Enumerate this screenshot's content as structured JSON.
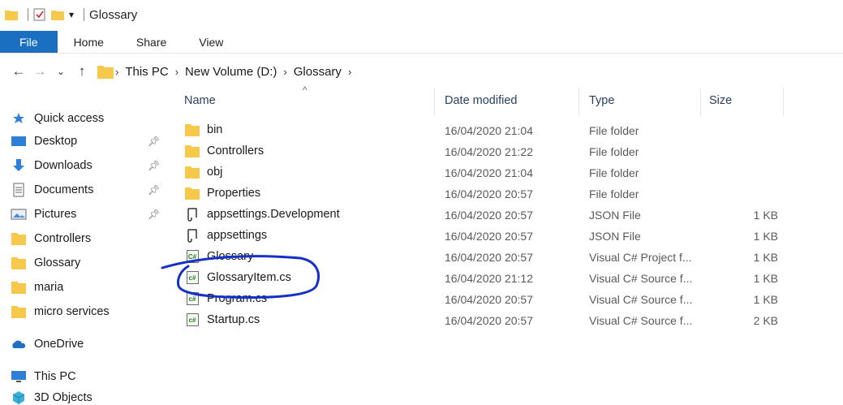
{
  "window": {
    "title": "Glossary",
    "ribbon_tabs": [
      {
        "label": "File",
        "active": true
      },
      {
        "label": "Home"
      },
      {
        "label": "Share"
      },
      {
        "label": "View"
      }
    ]
  },
  "navigation": {
    "back_icon": "arrow-left-icon",
    "forward_icon": "arrow-right-icon",
    "recent_icon": "chevron-down-icon",
    "up_icon": "arrow-up-icon",
    "breadcrumb": [
      "This PC",
      "New Volume (D:)",
      "Glossary"
    ]
  },
  "sidebar": {
    "items": [
      {
        "label": "Quick access",
        "icon": "star-icon"
      },
      {
        "label": "Desktop",
        "icon": "desktop-icon",
        "pinned": true
      },
      {
        "label": "Downloads",
        "icon": "download-icon",
        "pinned": true
      },
      {
        "label": "Documents",
        "icon": "documents-icon",
        "pinned": true
      },
      {
        "label": "Pictures",
        "icon": "pictures-icon",
        "pinned": true
      },
      {
        "label": "Controllers",
        "icon": "folder-icon"
      },
      {
        "label": "Glossary",
        "icon": "folder-icon"
      },
      {
        "label": "maria",
        "icon": "folder-icon"
      },
      {
        "label": "micro services",
        "icon": "folder-icon"
      },
      {
        "label": "OneDrive",
        "icon": "cloud-icon"
      },
      {
        "label": "This PC",
        "icon": "computer-icon"
      },
      {
        "label": "3D Objects",
        "icon": "cube-icon"
      }
    ]
  },
  "list": {
    "columns": [
      "Name",
      "Date modified",
      "Type",
      "Size"
    ],
    "rows": [
      {
        "name": "bin",
        "date": "16/04/2020 21:04",
        "type": "File folder",
        "size": "",
        "icon": "folder-icon"
      },
      {
        "name": "Controllers",
        "date": "16/04/2020 21:22",
        "type": "File folder",
        "size": "",
        "icon": "folder-icon"
      },
      {
        "name": "obj",
        "date": "16/04/2020 21:04",
        "type": "File folder",
        "size": "",
        "icon": "folder-icon"
      },
      {
        "name": "Properties",
        "date": "16/04/2020 20:57",
        "type": "File folder",
        "size": "",
        "icon": "folder-icon"
      },
      {
        "name": "appsettings.Development",
        "date": "16/04/2020 20:57",
        "type": "JSON File",
        "size": "1 KB",
        "icon": "json-file-icon"
      },
      {
        "name": "appsettings",
        "date": "16/04/2020 20:57",
        "type": "JSON File",
        "size": "1 KB",
        "icon": "json-file-icon"
      },
      {
        "name": "Glossary",
        "date": "16/04/2020 20:57",
        "type": "Visual C# Project f...",
        "size": "1 KB",
        "icon": "csproj-file-icon"
      },
      {
        "name": "GlossaryItem.cs",
        "date": "16/04/2020 21:12",
        "type": "Visual C# Source f...",
        "size": "1 KB",
        "icon": "cs-file-icon"
      },
      {
        "name": "Program.cs",
        "date": "16/04/2020 20:57",
        "type": "Visual C# Source f...",
        "size": "1 KB",
        "icon": "cs-file-icon"
      },
      {
        "name": "Startup.cs",
        "date": "16/04/2020 20:57",
        "type": "Visual C# Source f...",
        "size": "2 KB",
        "icon": "cs-file-icon"
      }
    ]
  },
  "colors": {
    "accent": "#1a6fc0",
    "folder": "#f6c84c",
    "annotation": "#1430c8"
  }
}
